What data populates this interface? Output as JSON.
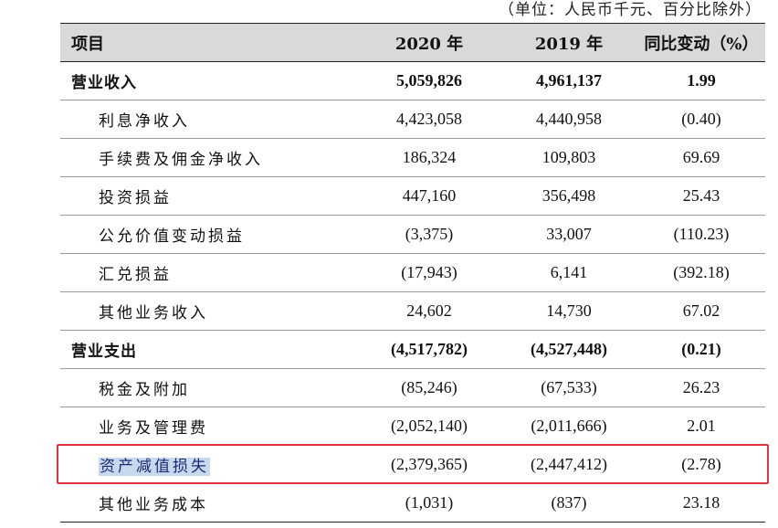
{
  "unit_note": "（单位：人民币千元、百分比除外）",
  "header": {
    "col_item": "项目",
    "col_2020": "2020 年",
    "col_2019": "2019 年",
    "col_change": "同比变动（%）"
  },
  "rows": [
    {
      "label": "营业收入",
      "v2020": "5,059,826",
      "v2019": "4,961,137",
      "change": "1.99"
    },
    {
      "label": "利息净收入",
      "v2020": "4,423,058",
      "v2019": "4,440,958",
      "change": "(0.40)"
    },
    {
      "label": "手续费及佣金净收入",
      "v2020": "186,324",
      "v2019": "109,803",
      "change": "69.69"
    },
    {
      "label": "投资损益",
      "v2020": "447,160",
      "v2019": "356,498",
      "change": "25.43"
    },
    {
      "label": "公允价值变动损益",
      "v2020": "(3,375)",
      "v2019": "33,007",
      "change": "(110.23)"
    },
    {
      "label": "汇兑损益",
      "v2020": "(17,943)",
      "v2019": "6,141",
      "change": "(392.18)"
    },
    {
      "label": "其他业务收入",
      "v2020": "24,602",
      "v2019": "14,730",
      "change": "67.02"
    },
    {
      "label": "营业支出",
      "v2020": "(4,517,782)",
      "v2019": "(4,527,448)",
      "change": "(0.21)"
    },
    {
      "label": "税金及附加",
      "v2020": "(85,246)",
      "v2019": "(67,533)",
      "change": "26.23"
    },
    {
      "label": "业务及管理费",
      "v2020": "(2,052,140)",
      "v2019": "(2,011,666)",
      "change": "2.01"
    },
    {
      "label": "资产减值损失",
      "v2020": "(2,379,365)",
      "v2019": "(2,447,412)",
      "change": "(2.78)"
    },
    {
      "label": "其他业务成本",
      "v2020": "(1,031)",
      "v2019": "(837)",
      "change": "23.18"
    }
  ],
  "colors": {
    "highlight_border": "#e0343a",
    "text_selection": "#c7d9ee",
    "header_bg": "#d9d9d9"
  }
}
